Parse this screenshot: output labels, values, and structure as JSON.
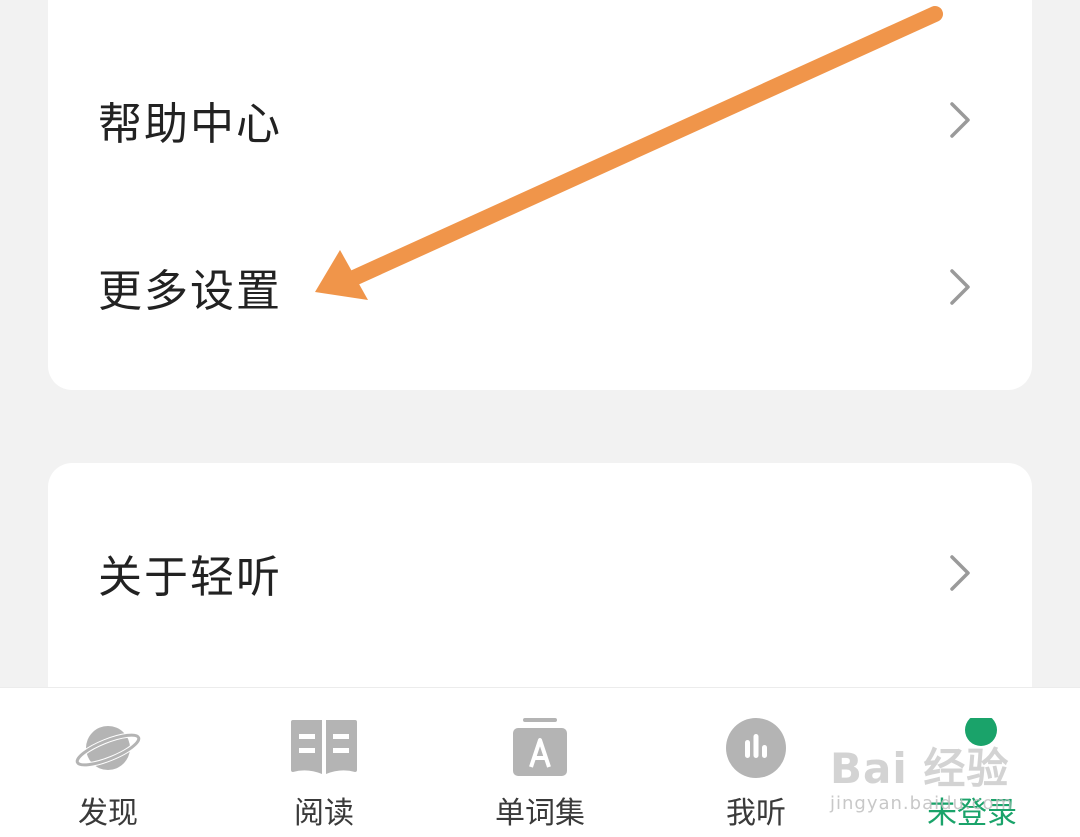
{
  "menu": {
    "help_center": "帮助中心",
    "more_settings": "更多设置",
    "about": "关于轻听"
  },
  "icons": {
    "chevron": "chevron-right-icon",
    "discover": "planet-icon",
    "read": "book-icon",
    "vocab": "letter-a-card-icon",
    "listen": "audio-bars-icon",
    "profile": "green-dot-icon"
  },
  "bottom_nav": {
    "discover": "发现",
    "read": "阅读",
    "vocab": "单词集",
    "listen": "我听",
    "profile": "未登录"
  },
  "annotation": {
    "arrow_color": "#f0954a"
  },
  "watermark": {
    "brand": "Bai 经验",
    "url": "jingyan.baidu.com"
  },
  "colors": {
    "accent": "#1aa36a",
    "icon_gray": "#b4b4b4",
    "text": "#222222"
  }
}
